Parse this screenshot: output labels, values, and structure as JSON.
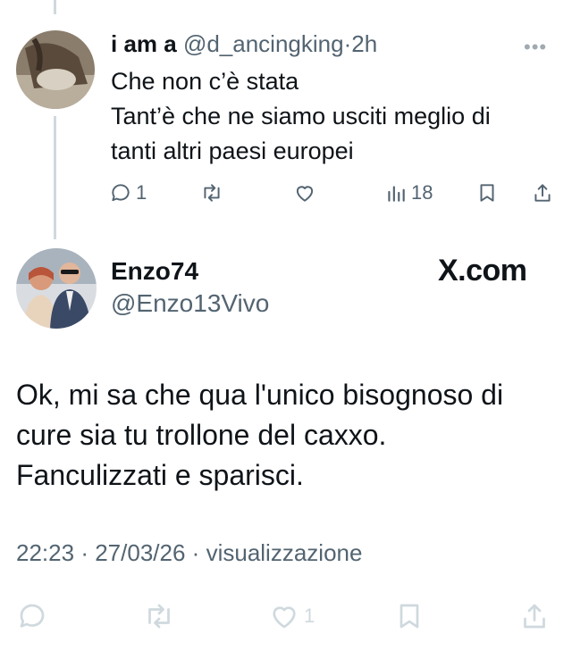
{
  "reply": {
    "display_name": "i am a",
    "handle": "@d_ancingking",
    "separator": "·",
    "time": "2h",
    "more_icon": "more-dots-icon",
    "lines": [
      "Che non c’è stata",
      "Tant’è che ne siamo usciti meglio di",
      "tanti altri paesi europei"
    ],
    "actions": {
      "reply_count": "1",
      "retweet_count": "",
      "like_count": "",
      "views_count": "18"
    }
  },
  "main_post": {
    "display_name": "Enzo74",
    "handle": "@Enzo13Vivo",
    "brand": "X.com",
    "lines": [
      "Ok, mi sa che qua l'unico bisognoso di",
      "cure sia tu trollone del caxxo.",
      "Fanculizzati e sparisci."
    ],
    "time": "22:23",
    "date": "27/03/26",
    "views_label": "visualizzazione",
    "sep": "·",
    "actions": {
      "like_count": "1"
    }
  },
  "colors": {
    "text": "#0f1419",
    "secondary": "#536471",
    "faded_icon": "#cfd9de",
    "thread_line": "#cfd9de"
  }
}
